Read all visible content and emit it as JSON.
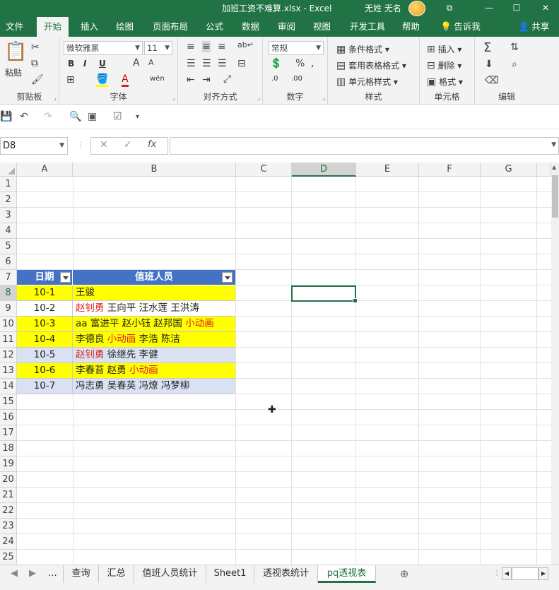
{
  "window": {
    "title": "加班工资不难算.xlsx  -  Excel",
    "user": "无姓 无名",
    "controls": [
      "⧉",
      "—",
      "☐",
      "✕"
    ]
  },
  "ribbon_tabs": [
    "文件",
    "开始",
    "插入",
    "绘图",
    "页面布局",
    "公式",
    "数据",
    "审阅",
    "视图",
    "开发工具",
    "帮助",
    "告诉我",
    "共享"
  ],
  "ribbon": {
    "clipboard": {
      "label": "剪贴板",
      "paste": "粘贴"
    },
    "font": {
      "label": "字体",
      "name": "微软雅黑",
      "size": "11",
      "bold": "B",
      "italic": "I",
      "underline": "U"
    },
    "alignment": {
      "label": "对齐方式"
    },
    "number": {
      "label": "数字",
      "format": "常规"
    },
    "styles": {
      "label": "样式",
      "conditional": "条件格式",
      "table": "套用表格格式",
      "cell": "单元格样式"
    },
    "cells": {
      "label": "单元格",
      "insert": "插入",
      "delete": "删除",
      "format": "格式"
    },
    "editing": {
      "label": "编辑"
    }
  },
  "namebox": "D8",
  "fx": "fx",
  "columns": [
    "A",
    "B",
    "C",
    "D",
    "E",
    "F",
    "G"
  ],
  "rows": [
    "1",
    "2",
    "3",
    "4",
    "5",
    "6",
    "7",
    "8",
    "9",
    "10",
    "11",
    "12",
    "13",
    "14",
    "15",
    "16",
    "17",
    "18",
    "19",
    "20",
    "21",
    "22",
    "23",
    "24",
    "25"
  ],
  "table": {
    "headers": [
      "日期",
      "值班人员"
    ],
    "rows": [
      {
        "date": "10-1",
        "people": [
          {
            "t": "王骏",
            "red": false
          }
        ]
      },
      {
        "date": "10-2",
        "people": [
          {
            "t": "赵钊勇",
            "red": true
          },
          {
            "t": " 王向平 汪水莲 王洪涛",
            "red": false
          }
        ]
      },
      {
        "date": "10-3",
        "people": [
          {
            "t": "aa 富进平 赵小钰 赵邦国 ",
            "red": false
          },
          {
            "t": "小动画",
            "red": true
          }
        ]
      },
      {
        "date": "10-4",
        "people": [
          {
            "t": "李德良 ",
            "red": false
          },
          {
            "t": "小动画",
            "red": true
          },
          {
            "t": " 李浩 陈洁",
            "red": false
          }
        ]
      },
      {
        "date": "10-5",
        "people": [
          {
            "t": "赵钊勇",
            "red": true
          },
          {
            "t": " 徐继先 李健",
            "red": false
          }
        ]
      },
      {
        "date": "10-6",
        "people": [
          {
            "t": "李春苔 赵勇 ",
            "red": false
          },
          {
            "t": "小动画",
            "red": true
          }
        ]
      },
      {
        "date": "10-7",
        "people": [
          {
            "t": "冯志勇 吴春英 冯燎 冯梦柳",
            "red": false
          }
        ]
      }
    ],
    "row_colors": [
      "#ffff00",
      "#ffffff",
      "#ffff00",
      "#ffff00",
      "#d9e1f2",
      "#ffff00",
      "#d9e1f2"
    ]
  },
  "sheets": [
    "...",
    "查询",
    "汇总",
    "值班人员统计",
    "Sheet1",
    "透视表统计",
    "pq透视表"
  ],
  "active_sheet": "pq透视表"
}
